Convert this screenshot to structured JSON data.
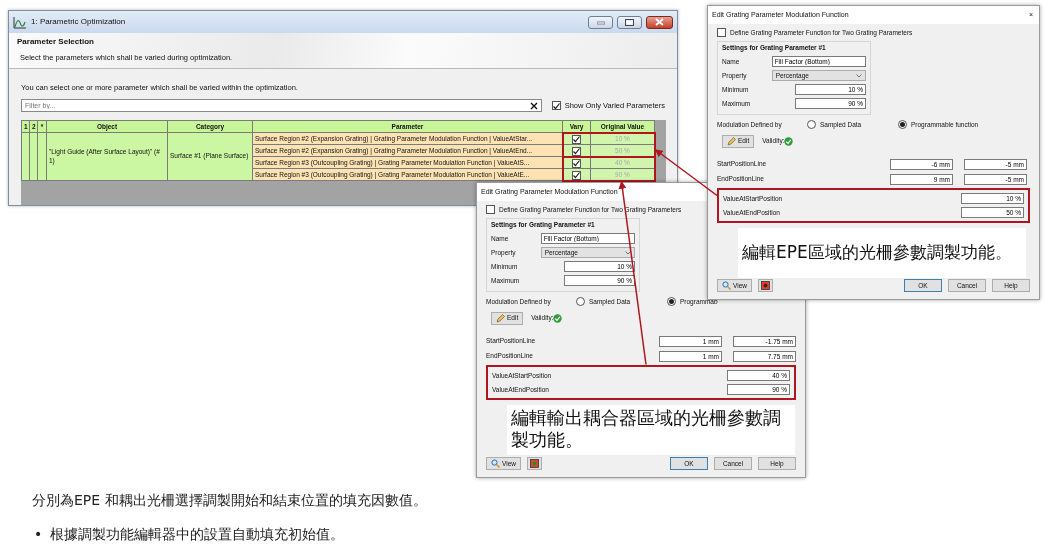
{
  "main_window": {
    "title": "1: Parametric Optimization",
    "header_title": "Parameter Selection",
    "header_subtitle": "Select the parameters which shall be varied during optimization.",
    "instruction": "You can select one or more parameter which shall be varied within the optimization.",
    "filter": {
      "placeholder": "Filter by..."
    },
    "show_only_varied": {
      "label": "Show Only Varied Parameters",
      "checked": true
    },
    "table": {
      "columns": [
        "1",
        "2",
        "*",
        "Object",
        "Category",
        "Parameter",
        "Vary",
        "Original Value"
      ],
      "object": "\"Light Guide (After Surface Layout)\" (# 1)",
      "category": "Surface #1 (Plane Surface)",
      "rows": [
        {
          "parameter": "Surface Region #2 (Expansion Grating) | Grating Parameter Modulation Function | ValueAtStar...",
          "vary": true,
          "original_value": "10 %"
        },
        {
          "parameter": "Surface Region #2 (Expansion Grating) | Grating Parameter Modulation Function | ValueAtEnd...",
          "vary": true,
          "original_value": "50 %"
        },
        {
          "parameter": "Surface Region #3 (Outcoupling Grating) | Grating Parameter Modulation Function | ValueAtS...",
          "vary": true,
          "original_value": "40 %"
        },
        {
          "parameter": "Surface Region #3 (Outcoupling Grating) | Grating Parameter Modulation Function | ValueAtE...",
          "vary": true,
          "original_value": "90 %"
        }
      ]
    }
  },
  "dialogs": [
    {
      "title": "Edit Grating Parameter Modulation Function",
      "close": "×",
      "two_params": {
        "label": "Define Grating Parameter Function for Two Grating Parameters",
        "checked": false
      },
      "group_title": "Settings for Grating Parameter #1",
      "name_label": "Name",
      "name_value": "Fill Factor (Bottom)",
      "property_label": "Property",
      "property_value": "Percentage",
      "minimum_label": "Minimum",
      "minimum_value": "10 %",
      "maximum_label": "Maximum",
      "maximum_value": "90 %",
      "modulation_label": "Modulation Defined by",
      "options": [
        {
          "label": "Sampled Data",
          "selected": false
        },
        {
          "label": "Programmable function",
          "selected": true
        }
      ],
      "edit_label": "Edit",
      "validity_label": "Validity:",
      "lines": [
        {
          "label": "StartPositionLine",
          "values": [
            "-6 mm",
            "-5 mm"
          ]
        },
        {
          "label": "EndPositionLine",
          "values": [
            "9 mm",
            "-5 mm"
          ]
        }
      ],
      "highlighted": [
        {
          "label": "ValueAtStartPosition",
          "value": "10 %"
        },
        {
          "label": "ValueAtEndPosition",
          "value": "50 %"
        }
      ],
      "caption": "編輯EPE區域的光柵參數調製功能。",
      "buttons": {
        "view": "View",
        "ok": "OK",
        "cancel": "Cancel",
        "help": "Help"
      }
    },
    {
      "title": "Edit Grating Parameter Modulation Function",
      "two_params": {
        "label": "Define Grating Parameter Function for Two Grating Parameters",
        "checked": false
      },
      "group_title": "Settings for Grating Parameter #1",
      "name_label": "Name",
      "name_value": "Fill Factor (Bottom)",
      "property_label": "Property",
      "property_value": "Percentage",
      "minimum_label": "Minimum",
      "minimum_value": "10 %",
      "maximum_label": "Maximum",
      "maximum_value": "90 %",
      "modulation_label": "Modulation Defined by",
      "options": [
        {
          "label": "Sampled Data",
          "selected": false
        },
        {
          "label": "Programmab",
          "selected": true
        }
      ],
      "edit_label": "Edit",
      "validity_label": "Validity:",
      "lines": [
        {
          "label": "StartPositionLine",
          "values": [
            "1 mm",
            "-1.75 mm"
          ]
        },
        {
          "label": "EndPositionLine",
          "values": [
            "1 mm",
            "7.75 mm"
          ]
        }
      ],
      "highlighted": [
        {
          "label": "ValueAtStartPosition",
          "value": "40 %"
        },
        {
          "label": "ValueAtEndPosition",
          "value": "90 %"
        }
      ],
      "caption": "編輯輸出耦合器區域的光柵參數調製功能。",
      "buttons": {
        "view": "View",
        "ok": "OK",
        "cancel": "Cancel",
        "help": "Help"
      }
    }
  ],
  "notes": [
    {
      "text": "分別為EPE 和耦出光柵選擇調製開始和結束位置的填充因數值。"
    },
    {
      "marker": "•",
      "text": "根據調製功能編輯器中的設置自動填充初始值。"
    }
  ]
}
